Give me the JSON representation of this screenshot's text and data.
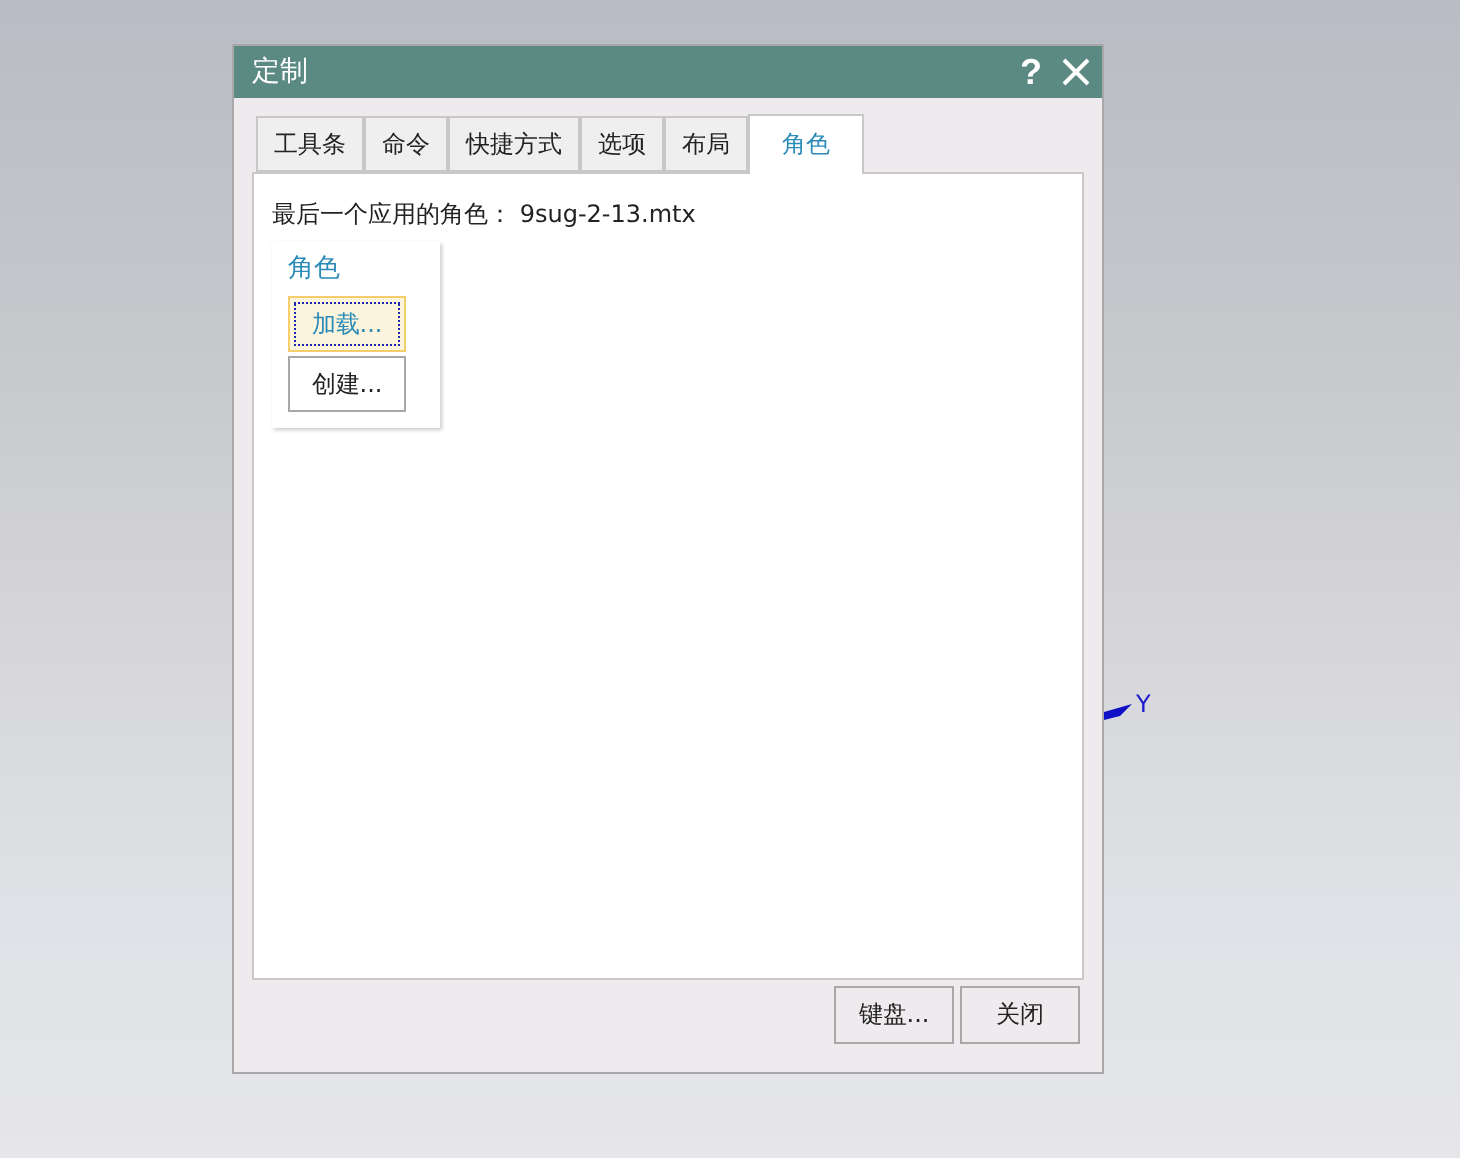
{
  "window": {
    "title": "定制",
    "help": "?"
  },
  "tabs": [
    {
      "label": "工具条",
      "selected": false
    },
    {
      "label": "命令",
      "selected": false
    },
    {
      "label": "快捷方式",
      "selected": false
    },
    {
      "label": "选项",
      "selected": false
    },
    {
      "label": "布局",
      "selected": false
    },
    {
      "label": "角色",
      "selected": true
    }
  ],
  "last_role": {
    "label": "最后一个应用的角色：",
    "value": "9sug-2-13.mtx"
  },
  "role_group": {
    "title": "角色",
    "buttons": [
      {
        "label": "加载...",
        "focused": true
      },
      {
        "label": "创建...",
        "focused": false
      }
    ]
  },
  "footer_buttons": [
    "键盘...",
    "关闭"
  ],
  "background": {
    "axis_label": "Y"
  }
}
